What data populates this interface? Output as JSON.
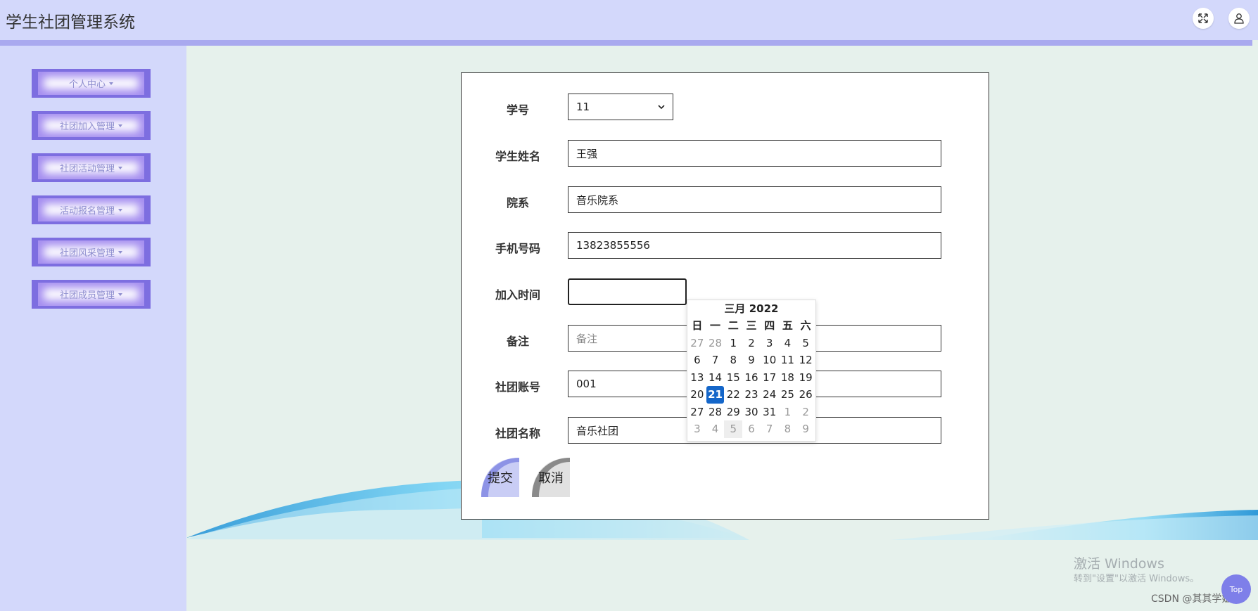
{
  "app": {
    "title": "学生社团管理系统"
  },
  "header": {
    "icons": [
      "fullscreen-icon",
      "user-icon"
    ]
  },
  "sidebar": {
    "items": [
      {
        "label": "个人中心"
      },
      {
        "label": "社团加入管理"
      },
      {
        "label": "社团活动管理"
      },
      {
        "label": "活动报名管理"
      },
      {
        "label": "社团风采管理"
      },
      {
        "label": "社团成员管理"
      }
    ]
  },
  "form": {
    "student_id": {
      "label": "学号",
      "value": "11"
    },
    "student_name": {
      "label": "学生姓名",
      "value": "王强"
    },
    "department": {
      "label": "院系",
      "value": "音乐院系"
    },
    "phone": {
      "label": "手机号码",
      "value": "13823855556"
    },
    "join_time": {
      "label": "加入时间",
      "value": ""
    },
    "remark": {
      "label": "备注",
      "placeholder": "备注"
    },
    "club_account": {
      "label": "社团账号",
      "value": "001"
    },
    "club_name": {
      "label": "社团名称",
      "value": "音乐社团"
    },
    "submit_label": "提交",
    "cancel_label": "取消"
  },
  "calendar": {
    "title": "三月 2022",
    "weekdays": [
      "日",
      "一",
      "二",
      "三",
      "四",
      "五",
      "六"
    ],
    "weeks": [
      [
        "27",
        "28",
        "1",
        "2",
        "3",
        "4",
        "5"
      ],
      [
        "6",
        "7",
        "8",
        "9",
        "10",
        "11",
        "12"
      ],
      [
        "13",
        "14",
        "15",
        "16",
        "17",
        "18",
        "19"
      ],
      [
        "20",
        "21",
        "22",
        "23",
        "24",
        "25",
        "26"
      ],
      [
        "27",
        "28",
        "29",
        "30",
        "31",
        "1",
        "2"
      ],
      [
        "3",
        "4",
        "5",
        "6",
        "7",
        "8",
        "9"
      ]
    ],
    "selected": "21"
  },
  "watermark": {
    "line1": "激活 Windows",
    "line2": "转到\"设置\"以激活 Windows。"
  },
  "credit": "CSDN @其其学姐",
  "top_button": "Top",
  "colors": {
    "header_bg": "#d3d8fb",
    "sidebar_accent": "#7d6ee0",
    "main_bg": "#e6f1ec",
    "calendar_selected": "#1466c9"
  }
}
